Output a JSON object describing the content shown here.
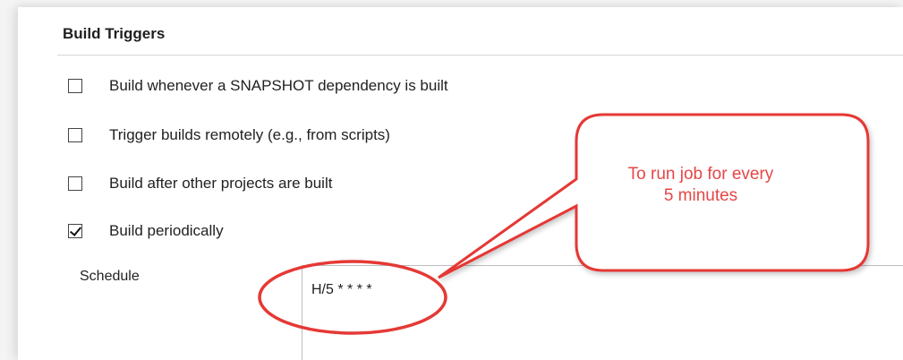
{
  "build_triggers": {
    "title": "Build Triggers",
    "options": [
      {
        "label": "Build whenever a SNAPSHOT dependency is built",
        "checked": false
      },
      {
        "label": "Trigger builds remotely (e.g., from scripts)",
        "checked": false
      },
      {
        "label": "Build after other projects are built",
        "checked": false
      },
      {
        "label": "Build periodically",
        "checked": true
      }
    ],
    "schedule": {
      "label": "Schedule",
      "value": "H/5 * * * *"
    }
  },
  "annotation": {
    "callout_line1": "To run job for every",
    "callout_line2": "5 minutes",
    "color": "#e53935"
  }
}
